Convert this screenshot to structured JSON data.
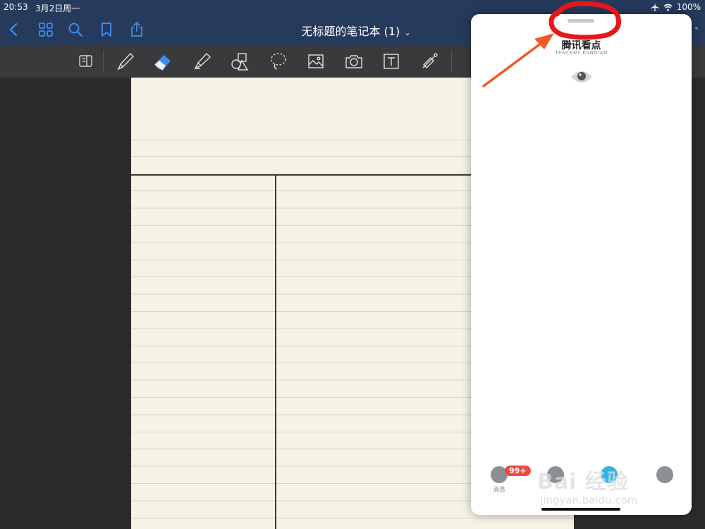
{
  "status_bar": {
    "time": "20:53",
    "date": "3月2日周一",
    "battery": "100%"
  },
  "nav_bar": {
    "title": "无标题的笔记本 (1)",
    "icons": [
      "chevron-left-icon",
      "grid-icon",
      "search-icon",
      "bookmark-icon",
      "share-icon"
    ]
  },
  "toolbar": {
    "tools": [
      "page-view-icon",
      "pen-icon",
      "eraser-icon",
      "highlighter-icon",
      "shapes-icon",
      "lasso-icon",
      "image-icon",
      "camera-icon",
      "text-icon",
      "laser-pointer-icon"
    ],
    "selected": "eraser-icon"
  },
  "slide_over": {
    "app_title": "腾讯看点",
    "app_subtitle": "TENCENT KANDIAN",
    "tabs": [
      {
        "label": "消息",
        "icon": "message-icon"
      },
      {
        "label": "",
        "icon": "profile-icon"
      },
      {
        "label": "",
        "icon": "home-icon"
      },
      {
        "label": "",
        "icon": "more-icon"
      }
    ],
    "badge": "99+"
  },
  "watermark": {
    "text": "Bai 经验",
    "url": "jingyan.baidu.com"
  },
  "colors": {
    "nav_bg": "#263a5c",
    "accent": "#3b8ef0",
    "paper": "#f6f3e6",
    "annotation_red": "#e5171a",
    "arrow_orange": "#ee5a24",
    "badge_red": "#ee4b3e"
  }
}
